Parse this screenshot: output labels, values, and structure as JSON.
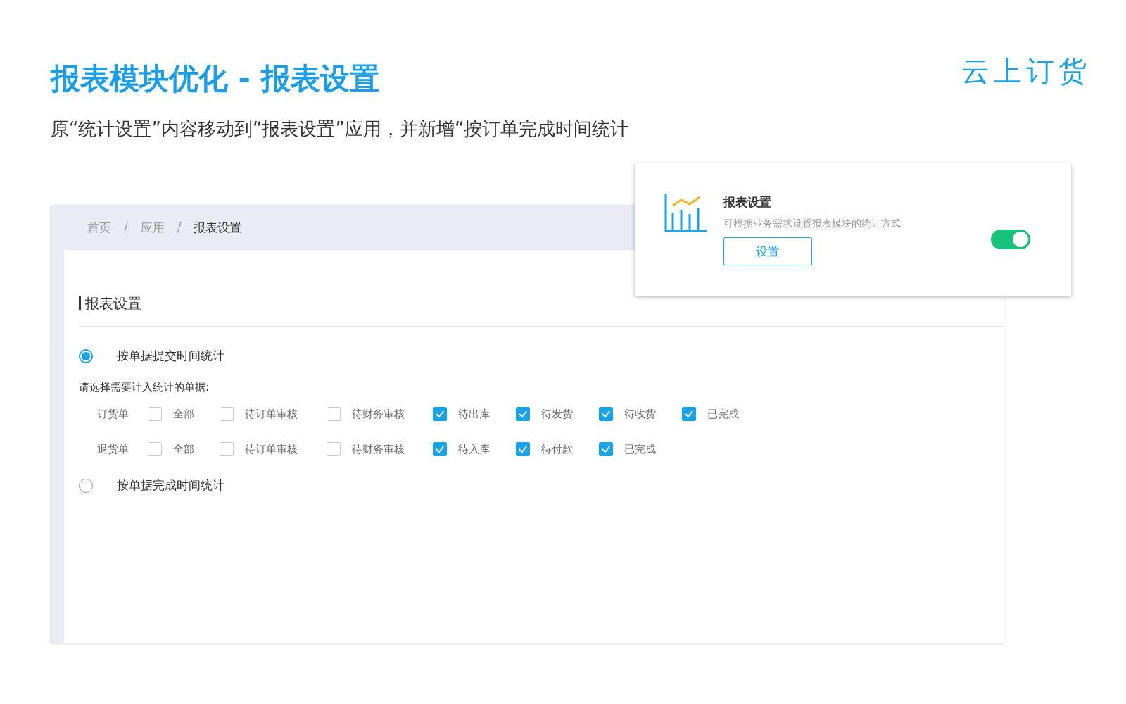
{
  "slide": {
    "title": "报表模块优化 - 报表设置",
    "subtitle": "原“统计设置”内容移动到“报表设置”应用，并新增“按订单完成时间统计",
    "logo": "云上订货"
  },
  "breadcrumb": [
    {
      "label": "首页",
      "current": false
    },
    {
      "label": "应用",
      "current": false
    },
    {
      "label": "报表设置",
      "current": true
    }
  ],
  "breadcrumb_separator": "/",
  "section_title": "报表设置",
  "options": [
    {
      "label": "按单据提交时间统计",
      "selected": true,
      "hint": "请选择需要计入统计的单据:",
      "groups": [
        {
          "label": "订货单",
          "items": [
            {
              "label": "全部",
              "checked": false
            },
            {
              "label": "待订单审核",
              "checked": false
            },
            {
              "label": "待财务审核",
              "checked": false
            },
            {
              "label": "待出库",
              "checked": true
            },
            {
              "label": "待发货",
              "checked": true
            },
            {
              "label": "待收货",
              "checked": true
            },
            {
              "label": "已完成",
              "checked": true
            }
          ]
        },
        {
          "label": "退货单",
          "items": [
            {
              "label": "全部",
              "checked": false
            },
            {
              "label": "待订单审核",
              "checked": false
            },
            {
              "label": "待财务审核",
              "checked": false
            },
            {
              "label": "待入库",
              "checked": true
            },
            {
              "label": "待付款",
              "checked": true
            },
            {
              "label": "已完成",
              "checked": true
            }
          ]
        }
      ]
    },
    {
      "label": "按单据完成时间统计",
      "selected": false
    }
  ],
  "app_card": {
    "title": "报表设置",
    "description": "可根据业务需求设置报表模块的统计方式",
    "button": "设置",
    "on": true
  }
}
